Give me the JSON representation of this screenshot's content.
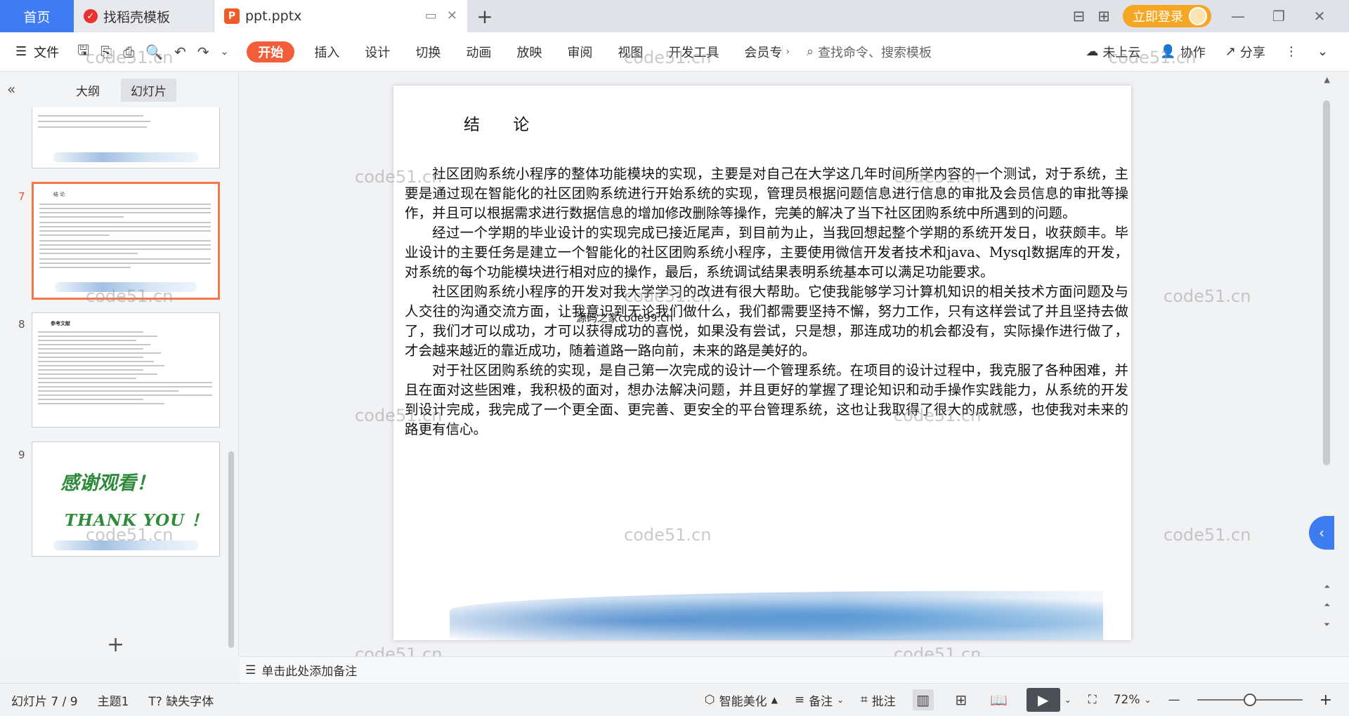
{
  "titlebar": {
    "home_tab": "首页",
    "docer_tab": "找稻壳模板",
    "doc_tab": "ppt.pptx",
    "login_label": "立即登录"
  },
  "ribbon": {
    "file_label": "文件",
    "tabs": [
      "开始",
      "插入",
      "设计",
      "切换",
      "动画",
      "放映",
      "审阅",
      "视图",
      "开发工具",
      "会员专"
    ],
    "search_placeholder": "查找命令、搜索模板",
    "cloud_label": "未上云",
    "collab_label": "协作",
    "share_label": "分享"
  },
  "leftpane": {
    "tab_outline": "大纲",
    "tab_slides": "幻灯片",
    "slide_numbers": [
      "7",
      "8",
      "9"
    ],
    "thumb7_title": "结 论",
    "thumb8_title": "参考文献",
    "thumb9_cn": "感谢观看！",
    "thumb9_en": "THANK  YOU ！"
  },
  "slide": {
    "title": "结 论",
    "paragraphs": [
      "社区团购系统小程序的整体功能模块的实现，主要是对自己在大学这几年时间所学内容的一个测试，对于系统，主要是通过现在智能化的社区团购系统进行开始系统的实现，管理员根据问题信息进行信息的审批及会员信息的审批等操作，并且可以根据需求进行数据信息的增加修改删除等操作，完美的解决了当下社区团购系统中所遇到的问题。",
      "经过一个学期的毕业设计的实现完成已接近尾声，到目前为止，当我回想起整个学期的系统开发日，收获颇丰。毕业设计的主要任务是建立一个智能化的社区团购系统小程序，主要使用微信开发者技术和java、Mysql数据库的开发，对系统的每个功能模块进行相对应的操作，最后，系统调试结果表明系统基本可以满足功能要求。",
      "社区团购系统小程序的开发对我大学学习的改进有很大帮助。它使我能够学习计算机知识的相关技术方面问题及与人交往的沟通交流方面，让我意识到无论我们做什么，我们都需要坚持不懈，努力工作，只有这样尝试了并且坚持去做了，我们才可以成功，才可以获得成功的喜悦，如果没有尝试，只是想，那连成功的机会都没有，实际操作进行做了，才会越来越近的靠近成功，随着道路一路向前，未来的路是美好的。",
      "对于社区团购系统的实现，是自己第一次完成的设计一个管理系统。在项目的设计过程中，我克服了各种困难，并且在面对这些困难，我积极的面对，想办法解决问题，并且更好的掌握了理论知识和动手操作实践能力，从系统的开发到设计完成，我完成了一个更全面、更完善、更安全的平台管理系统，这也让我取得了很大的成就感，也使我对未来的路更有信心。"
    ],
    "inline_watermark": "源码之家code99.cn"
  },
  "watermark_text": "code51.cn",
  "notes": {
    "placeholder": "单击此处添加备注"
  },
  "status": {
    "slide_indicator": "幻灯片 7 / 9",
    "theme": "主题1",
    "missing_font": "缺失字体",
    "beautify": "智能美化",
    "notes_btn": "备注",
    "comment_btn": "批注",
    "zoom": "72%",
    "zoom_level": 0.5
  },
  "colors": {
    "accent_blue": "#3f7cf4",
    "ribbon_active": "#f25d3a",
    "login_orange": "#f5a623",
    "thumb_selected": "#f07a4e",
    "thanks_green": "#2e8b3a"
  }
}
